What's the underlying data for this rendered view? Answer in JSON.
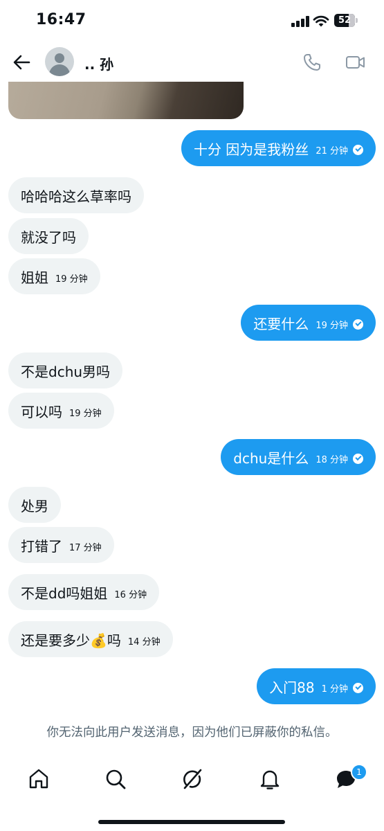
{
  "status_bar": {
    "time": "16:47",
    "battery": "52"
  },
  "header": {
    "user_name": ".. 孙"
  },
  "messages": [
    {
      "dir": "out",
      "text": "十分 因为是我粉丝",
      "time": "21 分钟"
    },
    {
      "dir": "in",
      "text": "哈哈哈这么草率吗",
      "time": ""
    },
    {
      "dir": "in",
      "text": "就没了吗",
      "time": ""
    },
    {
      "dir": "in",
      "text": "姐姐",
      "time": "19 分钟"
    },
    {
      "dir": "out",
      "text": "还要什么",
      "time": "19 分钟"
    },
    {
      "dir": "in",
      "text": "不是dchu男吗",
      "time": ""
    },
    {
      "dir": "in",
      "text": "可以吗",
      "time": "19 分钟"
    },
    {
      "dir": "out",
      "text": "dchu是什么",
      "time": "18 分钟"
    },
    {
      "dir": "in",
      "text": "处男",
      "time": ""
    },
    {
      "dir": "in",
      "text": "打错了",
      "time": "17 分钟"
    },
    {
      "dir": "in",
      "text": "不是dd吗姐姐",
      "time": "16 分钟"
    },
    {
      "dir": "in",
      "text": "还是要多少💰吗",
      "time": "14 分钟"
    },
    {
      "dir": "out",
      "text": "入门88",
      "time": "1 分钟"
    }
  ],
  "blocked_notice": "你无法向此用户发送消息，因为他们已屏蔽你的私信。",
  "bottom_nav": {
    "messages_badge": "1"
  },
  "colors": {
    "accent": "#1d9bf0",
    "incoming_bubble": "#eff3f4",
    "muted_text": "#536471"
  }
}
